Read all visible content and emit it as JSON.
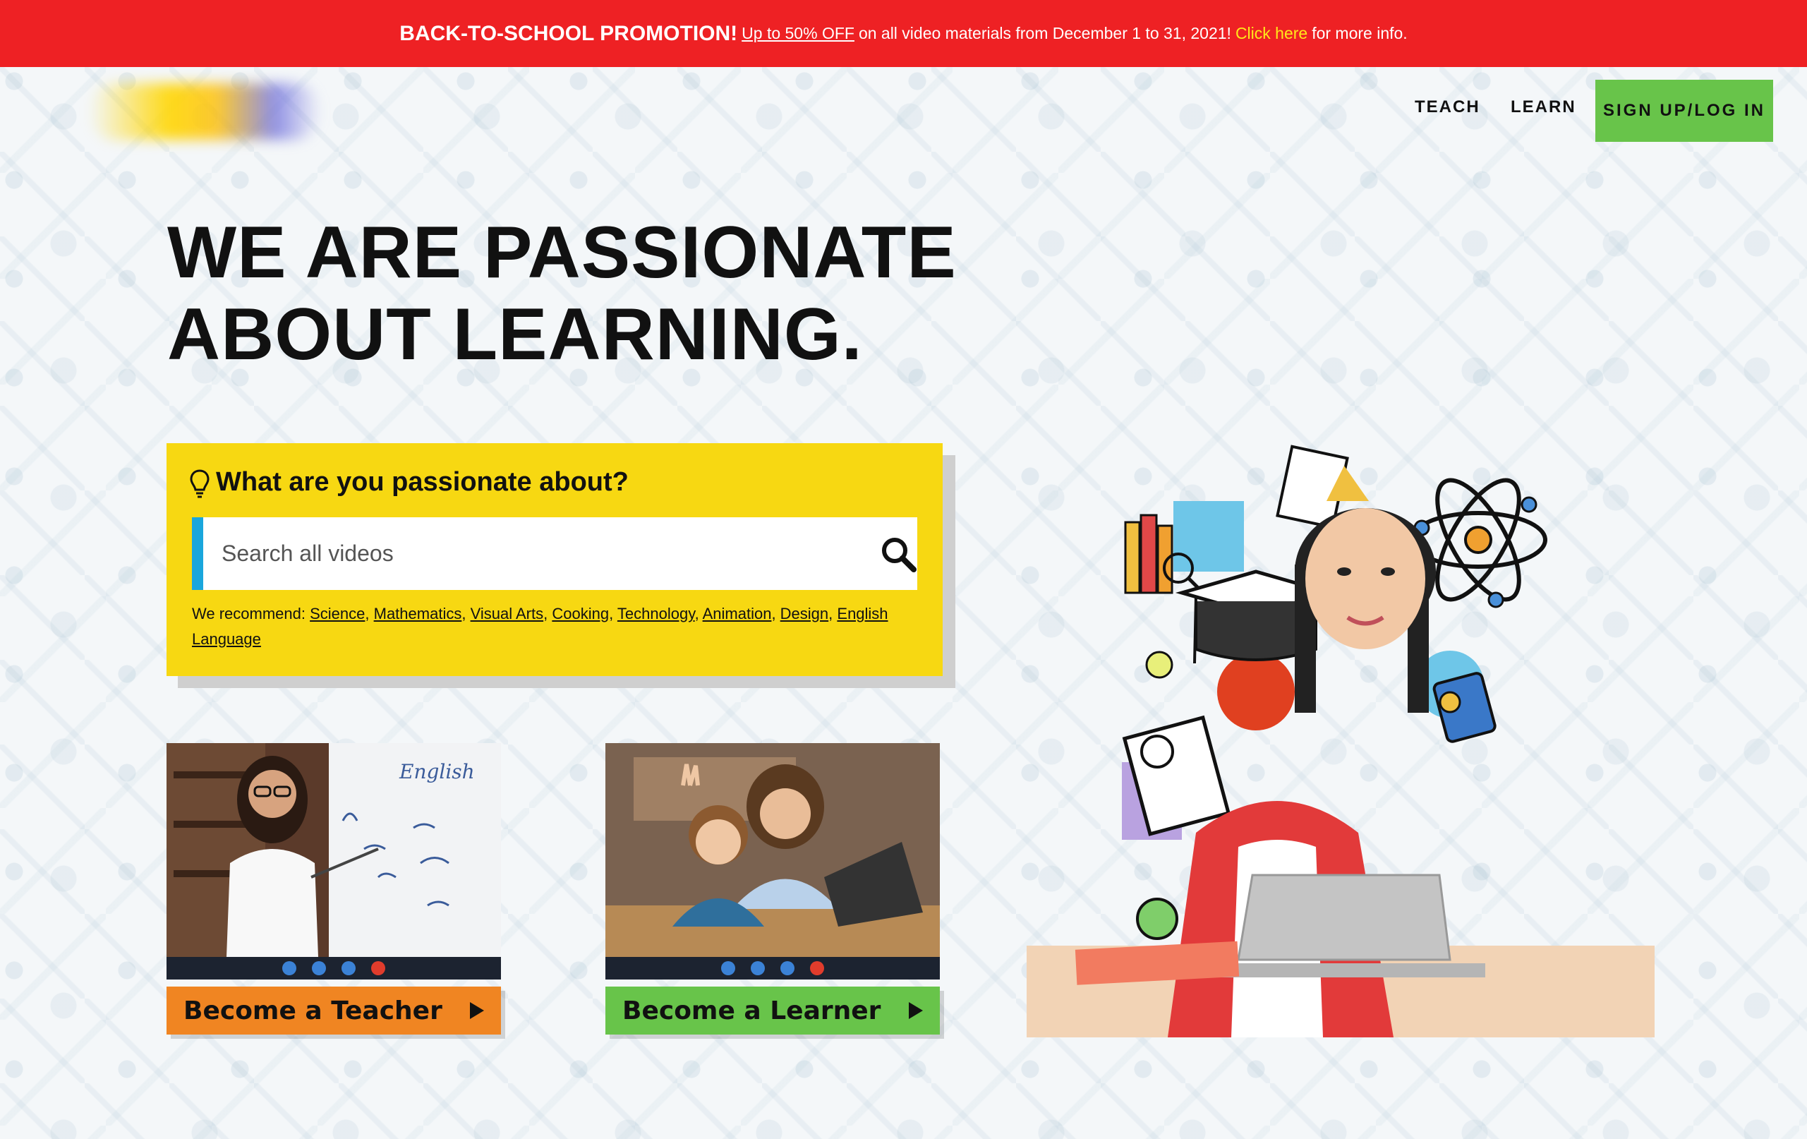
{
  "promo": {
    "title": "BACK-TO-SCHOOL PROMOTION!",
    "offer_link": "Up to 50% OFF",
    "middle": "on all video materials from December 1 to 31, 2021!",
    "click_link": "Click here",
    "end": "for more info."
  },
  "nav": {
    "teach": "TEACH",
    "learn": "LEARN",
    "signup": "SIGN UP/LOG IN"
  },
  "hero": {
    "line1": "WE ARE PASSIONATE",
    "line2": "ABOUT LEARNING."
  },
  "search": {
    "question": "What are you passionate about?",
    "placeholder": "Search all videos",
    "recommend_label": "We recommend:",
    "topics": [
      "Science",
      "Mathematics",
      "Visual Arts",
      "Cooking",
      "Technology",
      "Animation",
      "Design",
      "English Language"
    ]
  },
  "cards": {
    "teacher": {
      "label": "Become a Teacher",
      "board_text": "English"
    },
    "learner": {
      "label": "Become a Learner"
    }
  },
  "colors": {
    "promo_red": "#ee2124",
    "promo_link_yellow": "#ffe81a",
    "signup_green": "#68c44a",
    "search_yellow": "#f7d812",
    "search_accent_blue": "#1aa6dc",
    "teacher_orange": "#f08522",
    "learner_green": "#68c44a"
  },
  "icons": [
    "lightbulb-icon",
    "search-icon",
    "play-icon",
    "video-call-controls"
  ]
}
